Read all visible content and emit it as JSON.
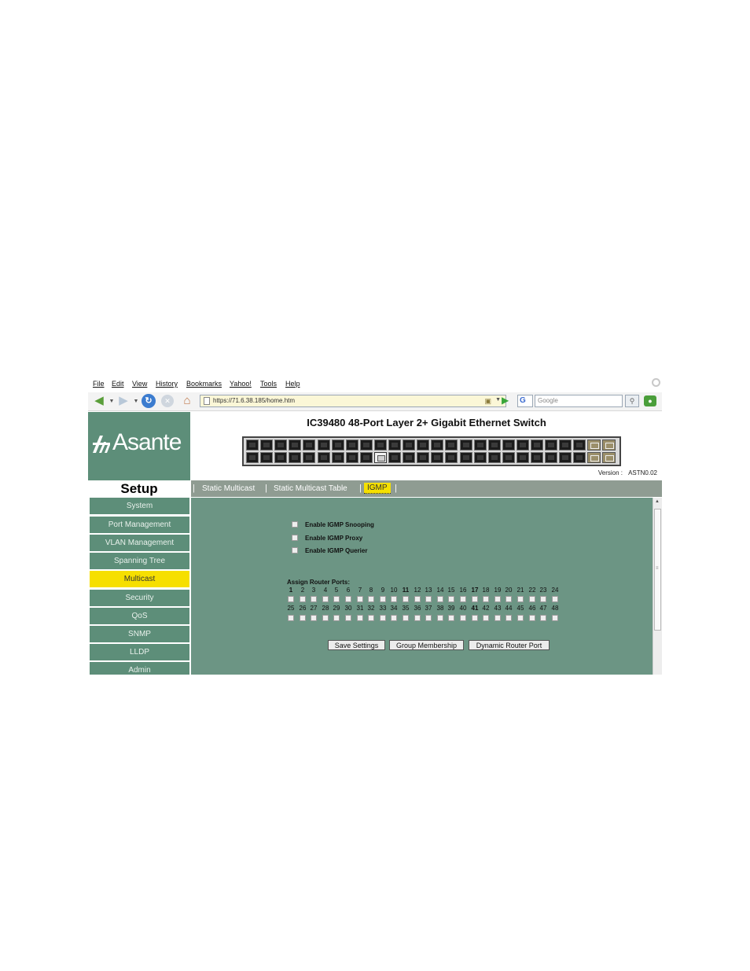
{
  "browser": {
    "menu": [
      "File",
      "Edit",
      "View",
      "History",
      "Bookmarks",
      "Yahoo!",
      "Tools",
      "Help"
    ],
    "url": "https://71.6.38.185/home.htm",
    "search_placeholder": "Google"
  },
  "brand": {
    "logo_text": "Asante"
  },
  "header": {
    "title": "IC39480 48-Port Layer 2+ Gigabit Ethernet Switch",
    "version_label": "Version :",
    "version_value": "ASTN0.02"
  },
  "sidebar": {
    "section_title": "Setup",
    "items": [
      {
        "label": "System"
      },
      {
        "label": "Port Management"
      },
      {
        "label": "VLAN Management"
      },
      {
        "label": "Spanning Tree"
      },
      {
        "label": "Multicast"
      },
      {
        "label": "Security"
      },
      {
        "label": "QoS"
      },
      {
        "label": "SNMP"
      },
      {
        "label": "LLDP"
      },
      {
        "label": "Admin"
      }
    ],
    "active_item": "Multicast"
  },
  "tabs": {
    "items": [
      {
        "label": "Static Multicast"
      },
      {
        "label": "Static Multicast Table"
      },
      {
        "label": "IGMP"
      }
    ],
    "active_tab": "IGMP"
  },
  "igmp": {
    "options": [
      {
        "label": "Enable IGMP Snooping",
        "checked": false
      },
      {
        "label": "Enable IGMP Proxy",
        "checked": false
      },
      {
        "label": "Enable IGMP Querier",
        "checked": false
      }
    ],
    "assign_label": "Assign Router Ports:",
    "port_row1": [
      "1",
      "2",
      "3",
      "4",
      "5",
      "6",
      "7",
      "8",
      "9",
      "10",
      "11",
      "12",
      "13",
      "14",
      "15",
      "16",
      "17",
      "18",
      "19",
      "20",
      "21",
      "22",
      "23",
      "24"
    ],
    "port_row2": [
      "25",
      "26",
      "27",
      "28",
      "29",
      "30",
      "31",
      "32",
      "33",
      "34",
      "35",
      "36",
      "37",
      "38",
      "39",
      "40",
      "41",
      "42",
      "43",
      "44",
      "45",
      "46",
      "47",
      "48"
    ],
    "router_ports_checked": []
  },
  "buttons": {
    "save": "Save Settings",
    "group_membership": "Group Membership",
    "dynamic_router_port": "Dynamic Router Port"
  },
  "switch_panel": {
    "active_port_indicator": "port-up"
  },
  "colors": {
    "panel_green": "#5d8e79",
    "content_green": "#6c9584",
    "tab_gray": "#8f9c92",
    "highlight_yellow": "#f6df00"
  }
}
